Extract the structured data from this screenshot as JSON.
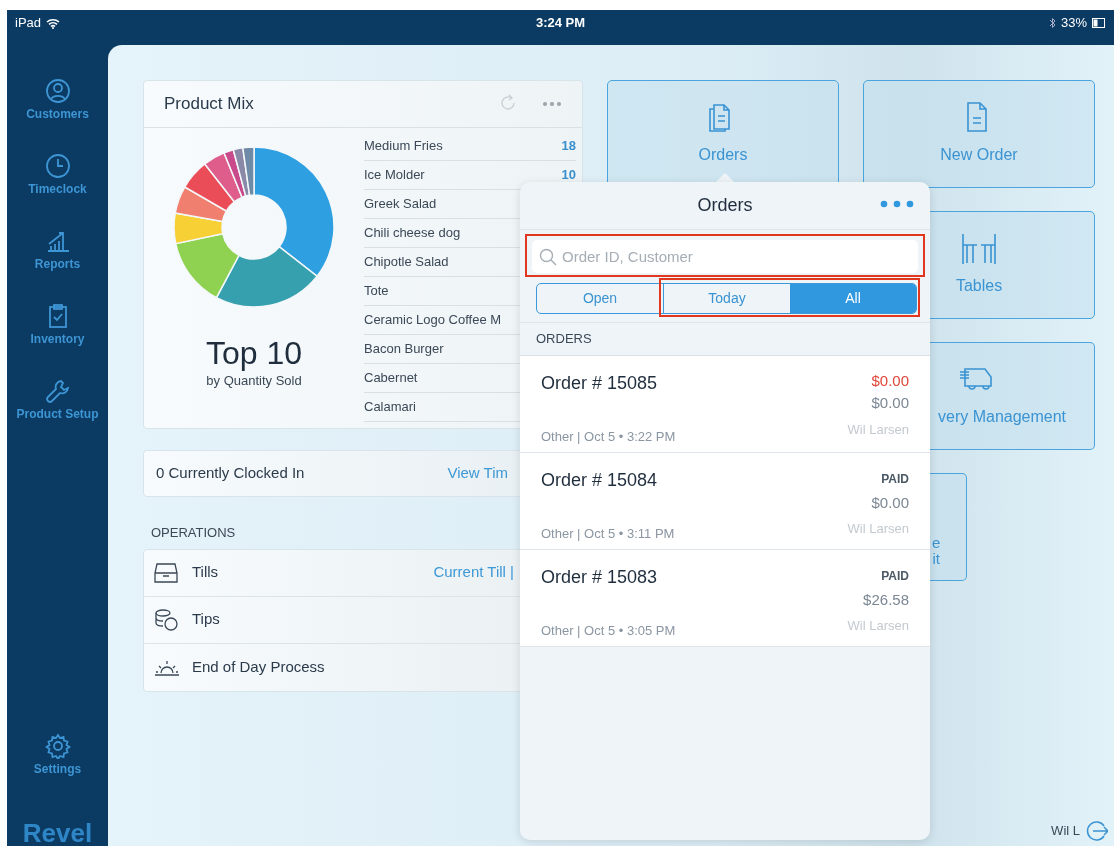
{
  "status_bar": {
    "device": "iPad",
    "time": "3:24 PM",
    "battery": "33%"
  },
  "sidebar": {
    "items": [
      {
        "label": "Customers"
      },
      {
        "label": "Timeclock"
      },
      {
        "label": "Reports"
      },
      {
        "label": "Inventory"
      },
      {
        "label": "Product Setup"
      }
    ],
    "bottom_items": [
      {
        "label": "Settings"
      }
    ],
    "logo": "Revel"
  },
  "product_mix": {
    "title": "Product Mix",
    "headline": "Top 10",
    "subtitle": "by Quantity Sold",
    "items": [
      {
        "name": "Medium Fries",
        "count": "18"
      },
      {
        "name": "Ice Molder",
        "count": "10"
      },
      {
        "name": "Greek Salad"
      },
      {
        "name": "Chili cheese dog"
      },
      {
        "name": "Chipotle Salad"
      },
      {
        "name": "Tote"
      },
      {
        "name": "Ceramic Logo Coffee M"
      },
      {
        "name": "Bacon Burger"
      },
      {
        "name": "Cabernet"
      },
      {
        "name": "Calamari"
      }
    ]
  },
  "clocked_in": {
    "label": "0 Currently Clocked In",
    "link": "View Tim"
  },
  "operations": {
    "heading": "OPERATIONS",
    "items": [
      {
        "label": "Tills",
        "link": "Current Till |"
      },
      {
        "label": "Tips"
      },
      {
        "label": "End of Day Process"
      }
    ]
  },
  "tiles": [
    {
      "label": "Orders"
    },
    {
      "label": "New Order"
    },
    {
      "label": "Tables"
    },
    {
      "label": "very Management"
    },
    {
      "label": "e\nit"
    }
  ],
  "orders_popover": {
    "title": "Orders",
    "search": {
      "placeholder": "Order ID, Customer",
      "highlighted": true
    },
    "segments": [
      {
        "label": "Open",
        "selected": false,
        "highlighted": false
      },
      {
        "label": "Today",
        "selected": false,
        "highlighted": true
      },
      {
        "label": "All",
        "selected": true,
        "highlighted": true
      }
    ],
    "section": "ORDERS",
    "orders": [
      {
        "title": "Order # 15085",
        "kind": "due",
        "status": "$0.00",
        "total": "$0.00",
        "meta": "Other | Oct 5 • 3:22 PM",
        "employee": "Wil Larsen"
      },
      {
        "title": "Order # 15084",
        "kind": "paid",
        "status": "PAID",
        "total": "$0.00",
        "meta": "Other | Oct 5 • 3:11 PM",
        "employee": "Wil Larsen"
      },
      {
        "title": "Order # 15083",
        "kind": "paid",
        "status": "PAID",
        "total": "$26.58",
        "meta": "Other | Oct 5 • 3:05 PM",
        "employee": "Wil Larsen"
      }
    ]
  },
  "user": {
    "name": "Wil L"
  }
}
